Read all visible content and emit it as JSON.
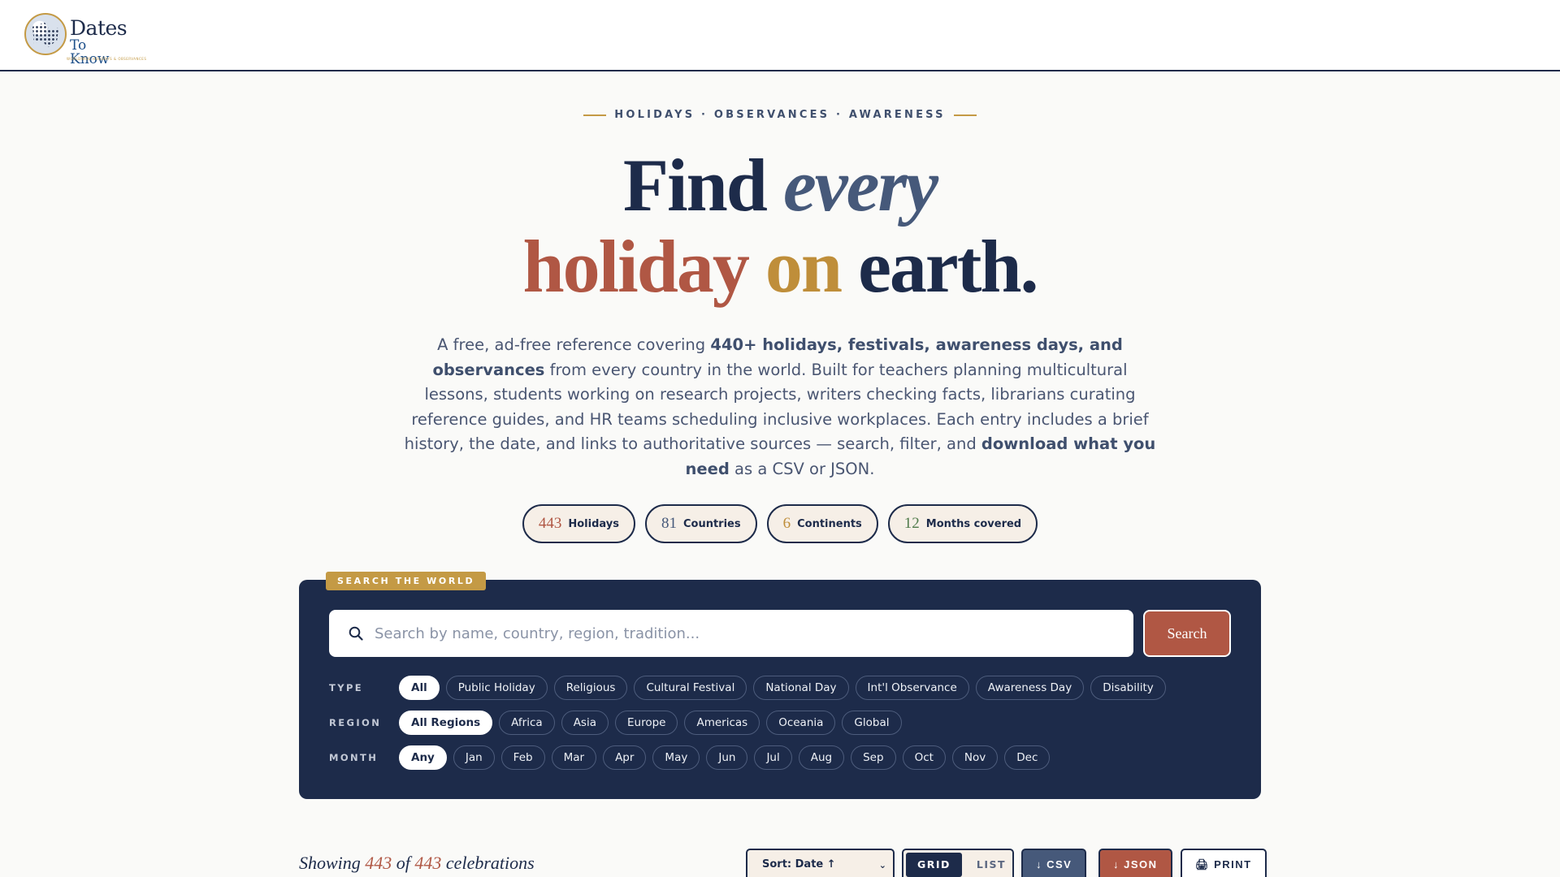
{
  "brand": {
    "title": "Dates",
    "subtitle": "To Know",
    "tagline": "WORLDWIDE HOLIDAYS & OBSERVANCES"
  },
  "hero": {
    "eyebrow": "HOLIDAYS · OBSERVANCES · AWARENESS",
    "headline_1": "Find",
    "headline_2": "every",
    "headline_3": "holiday",
    "headline_4": "on",
    "headline_5": "earth.",
    "intro_1": "A free, ad-free reference covering ",
    "intro_bold_1": "440+ holidays, festivals, awareness days, and observances",
    "intro_2": " from every country in the world. Built for teachers planning multicultural lessons, students working on research projects, writers checking facts, librarians curating reference guides, and HR teams scheduling inclusive workplaces. Each entry includes a brief history, the date, and links to authoritative sources — search, filter, and ",
    "intro_bold_2": "download what you need",
    "intro_3": " as a CSV or JSON."
  },
  "stats": [
    {
      "num": "443",
      "label": "Holidays",
      "color": "#b05744"
    },
    {
      "num": "81",
      "label": "Countries",
      "color": "#46597a"
    },
    {
      "num": "6",
      "label": "Continents",
      "color": "#bf8e3a"
    },
    {
      "num": "12",
      "label": "Months covered",
      "color": "#4f7a4a"
    }
  ],
  "search": {
    "tag": "SEARCH THE WORLD",
    "placeholder": "Search by name, country, region, tradition...",
    "button": "Search",
    "icon": "search-icon"
  },
  "filters": {
    "type_label": "TYPE",
    "types": [
      "All",
      "Public Holiday",
      "Religious",
      "Cultural Festival",
      "National Day",
      "Int'l Observance",
      "Awareness Day",
      "Disability"
    ],
    "region_label": "REGION",
    "regions": [
      "All Regions",
      "Africa",
      "Asia",
      "Europe",
      "Americas",
      "Oceania",
      "Global"
    ],
    "month_label": "MONTH",
    "months": [
      "Any",
      "Jan",
      "Feb",
      "Mar",
      "Apr",
      "May",
      "Jun",
      "Jul",
      "Aug",
      "Sep",
      "Oct",
      "Nov",
      "Dec"
    ]
  },
  "results": {
    "showing_prefix": "Showing",
    "shown": "443",
    "of": "of",
    "total": "443",
    "suffix": "celebrations",
    "sort": "Sort: Date ↑",
    "view_grid": "GRID",
    "view_list": "LIST",
    "csv": "↓ CSV",
    "json": "↓ JSON",
    "print": "🖨 PRINT"
  },
  "colors": {
    "navy": "#1d2b4a",
    "rust": "#b05744",
    "gold": "#c49a45",
    "slate": "#46597a"
  }
}
